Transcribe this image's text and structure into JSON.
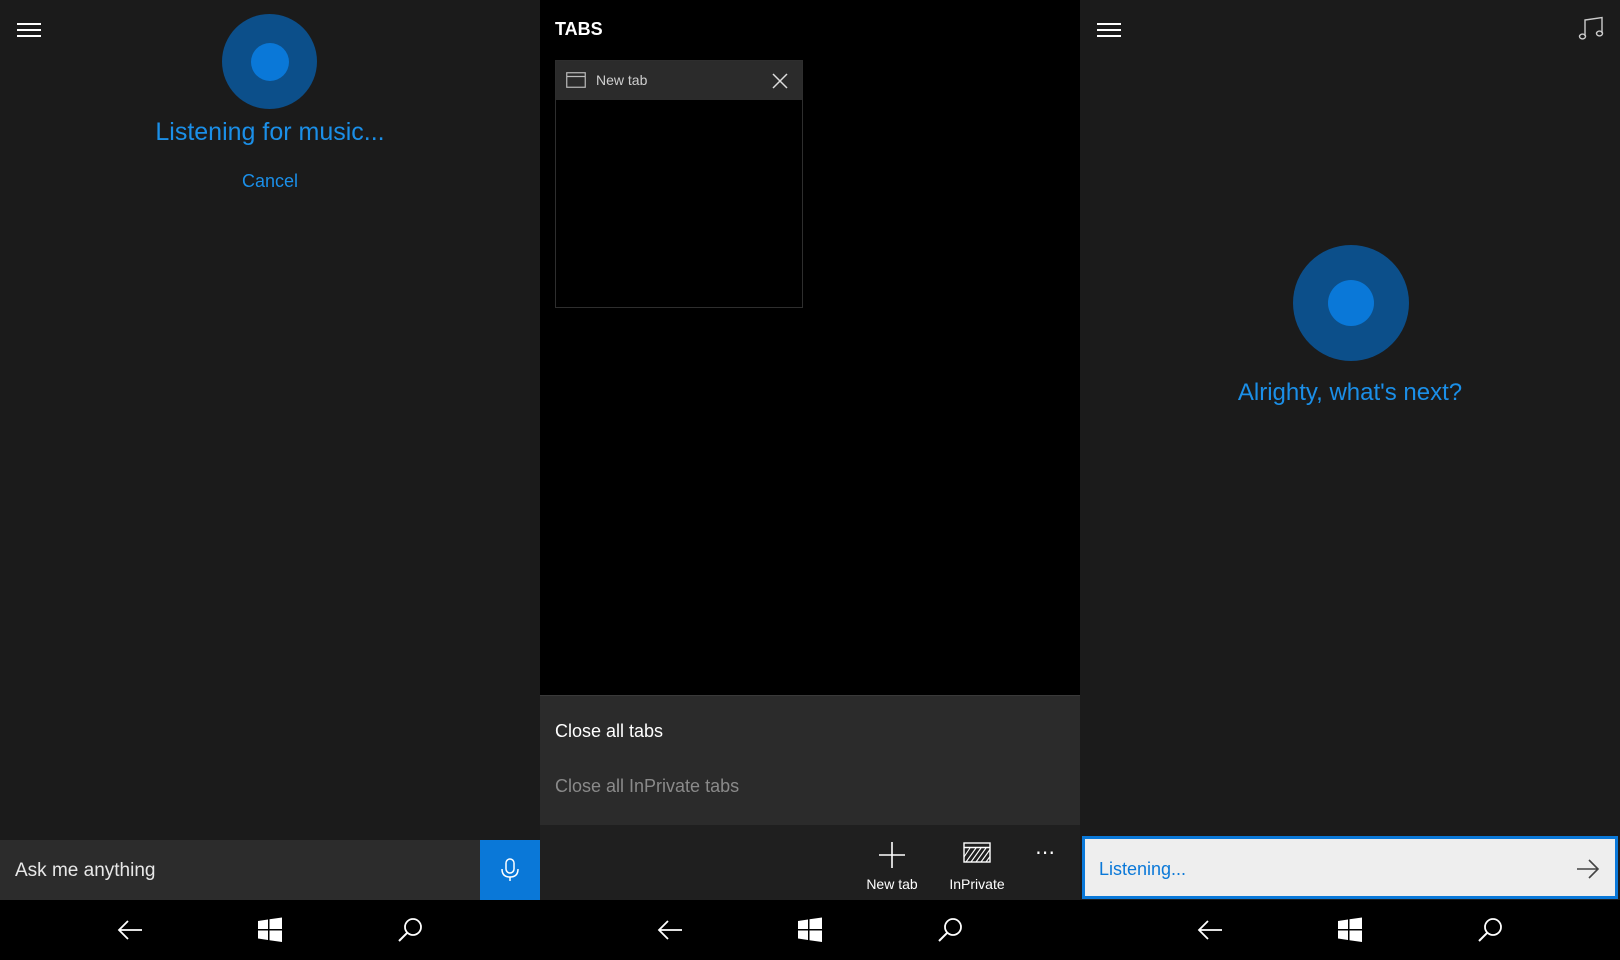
{
  "colors": {
    "accent": "#0a78d8",
    "cortana_text": "#1b8fe8",
    "panel_bg": "#1b1b1b",
    "nav_bg": "#000000"
  },
  "icons": {
    "menu": "hamburger-icon",
    "microphone": "microphone-icon",
    "back": "back-arrow-icon",
    "windows": "windows-logo-icon",
    "search": "search-icon",
    "tab": "tab-window-icon",
    "close": "close-icon",
    "add": "plus-icon",
    "inprivate": "inprivate-icon",
    "more": "more-icon",
    "music": "music-note-icon",
    "submit": "arrow-right-icon"
  },
  "cortana_listening": {
    "status": "Listening for music...",
    "cancel_label": "Cancel",
    "search_placeholder": "Ask me anything"
  },
  "tabs_view": {
    "title": "TABS",
    "tabs": [
      {
        "title": "New tab"
      }
    ],
    "menu": {
      "close_all": "Close all tabs",
      "close_all_inprivate": "Close all InPrivate tabs"
    },
    "appbar": {
      "new_tab_label": "New tab",
      "inprivate_label": "InPrivate",
      "more_label": "⋯"
    }
  },
  "cortana_next": {
    "status": "Alrighty, what's next?",
    "input_text": "Listening..."
  }
}
